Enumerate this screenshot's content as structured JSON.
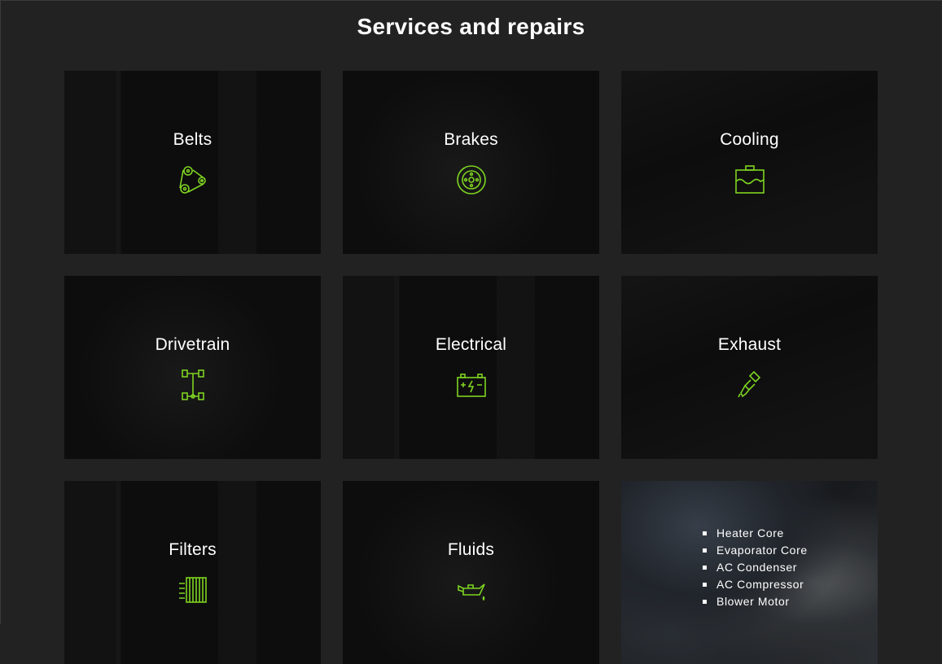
{
  "page": {
    "title": "Services and repairs"
  },
  "colors": {
    "background": "#222222",
    "tile": "#0d0d0d",
    "icon_accent": "#7ed321",
    "text": "#ffffff"
  },
  "services": [
    {
      "label": "Belts",
      "icon": "belt-pulley-icon"
    },
    {
      "label": "Brakes",
      "icon": "brake-disc-icon"
    },
    {
      "label": "Cooling",
      "icon": "coolant-reservoir-icon"
    },
    {
      "label": "Drivetrain",
      "icon": "drivetrain-axle-icon"
    },
    {
      "label": "Electrical",
      "icon": "battery-icon"
    },
    {
      "label": "Exhaust",
      "icon": "exhaust-pipe-icon"
    },
    {
      "label": "Filters",
      "icon": "air-filter-icon"
    },
    {
      "label": "Fluids",
      "icon": "oil-can-icon"
    }
  ],
  "hvac_tile": {
    "items": [
      "Heater Core",
      "Evaporator Core",
      "AC Condenser",
      "AC Compressor",
      "Blower Motor"
    ]
  }
}
